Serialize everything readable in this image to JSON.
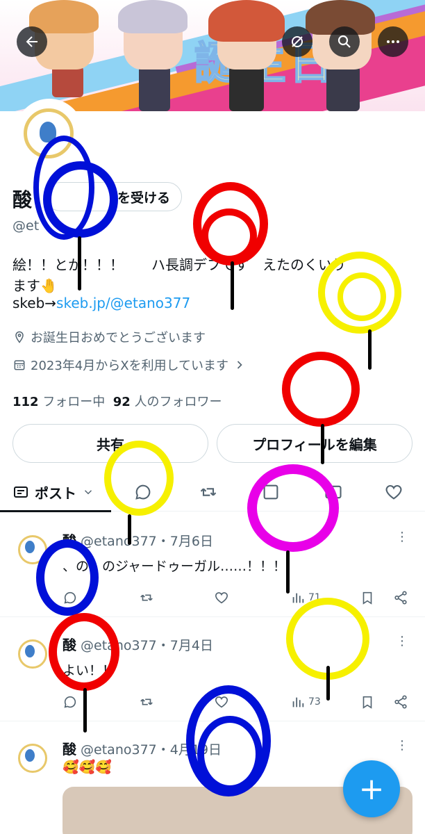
{
  "banner": {
    "title_text": "誕生日",
    "back_icon": "arrow-left-icon",
    "hide_icon": "eye-off-icon",
    "search_icon": "search-icon",
    "more_icon": "more-horizontal-icon"
  },
  "profile": {
    "name": "酸",
    "follow_button_label": "を受ける",
    "handle": "@et",
    "bio_line1": "絵！！とか！！！　　ハ長調デフです　えたのくいり",
    "bio_line2": "ます🤚",
    "skeb_prefix": "skeb→",
    "skeb_link": "skeb.jp/@etano377",
    "birthday": "お誕生日おめでとうございます",
    "joined": "2023年4月からXを利用しています",
    "following_count": "112",
    "following_label": "フォロー中",
    "followers_count": "92",
    "followers_label": "人のフォロワー",
    "share_label": "共有",
    "edit_label": "プロフィールを編集"
  },
  "tabs": {
    "posts_label": "ポスト"
  },
  "posts": [
    {
      "name": "酸",
      "meta": "@etano377・7月6日",
      "text": "、の、のジャードゥーガル……！！！",
      "views": "71"
    },
    {
      "name": "酸",
      "meta": "@etano377・7月4日",
      "text": "よい！！",
      "views": "73"
    },
    {
      "name": "酸",
      "meta": "@etano377・4月19日",
      "text": "🥰🥰🥰"
    }
  ],
  "colors": {
    "accent": "#1d9bf0",
    "scribble_blue": "#0010d8",
    "scribble_red": "#f00000",
    "scribble_yellow": "#f6f000",
    "scribble_magenta": "#e800e8"
  },
  "fab": {
    "label": "+"
  }
}
